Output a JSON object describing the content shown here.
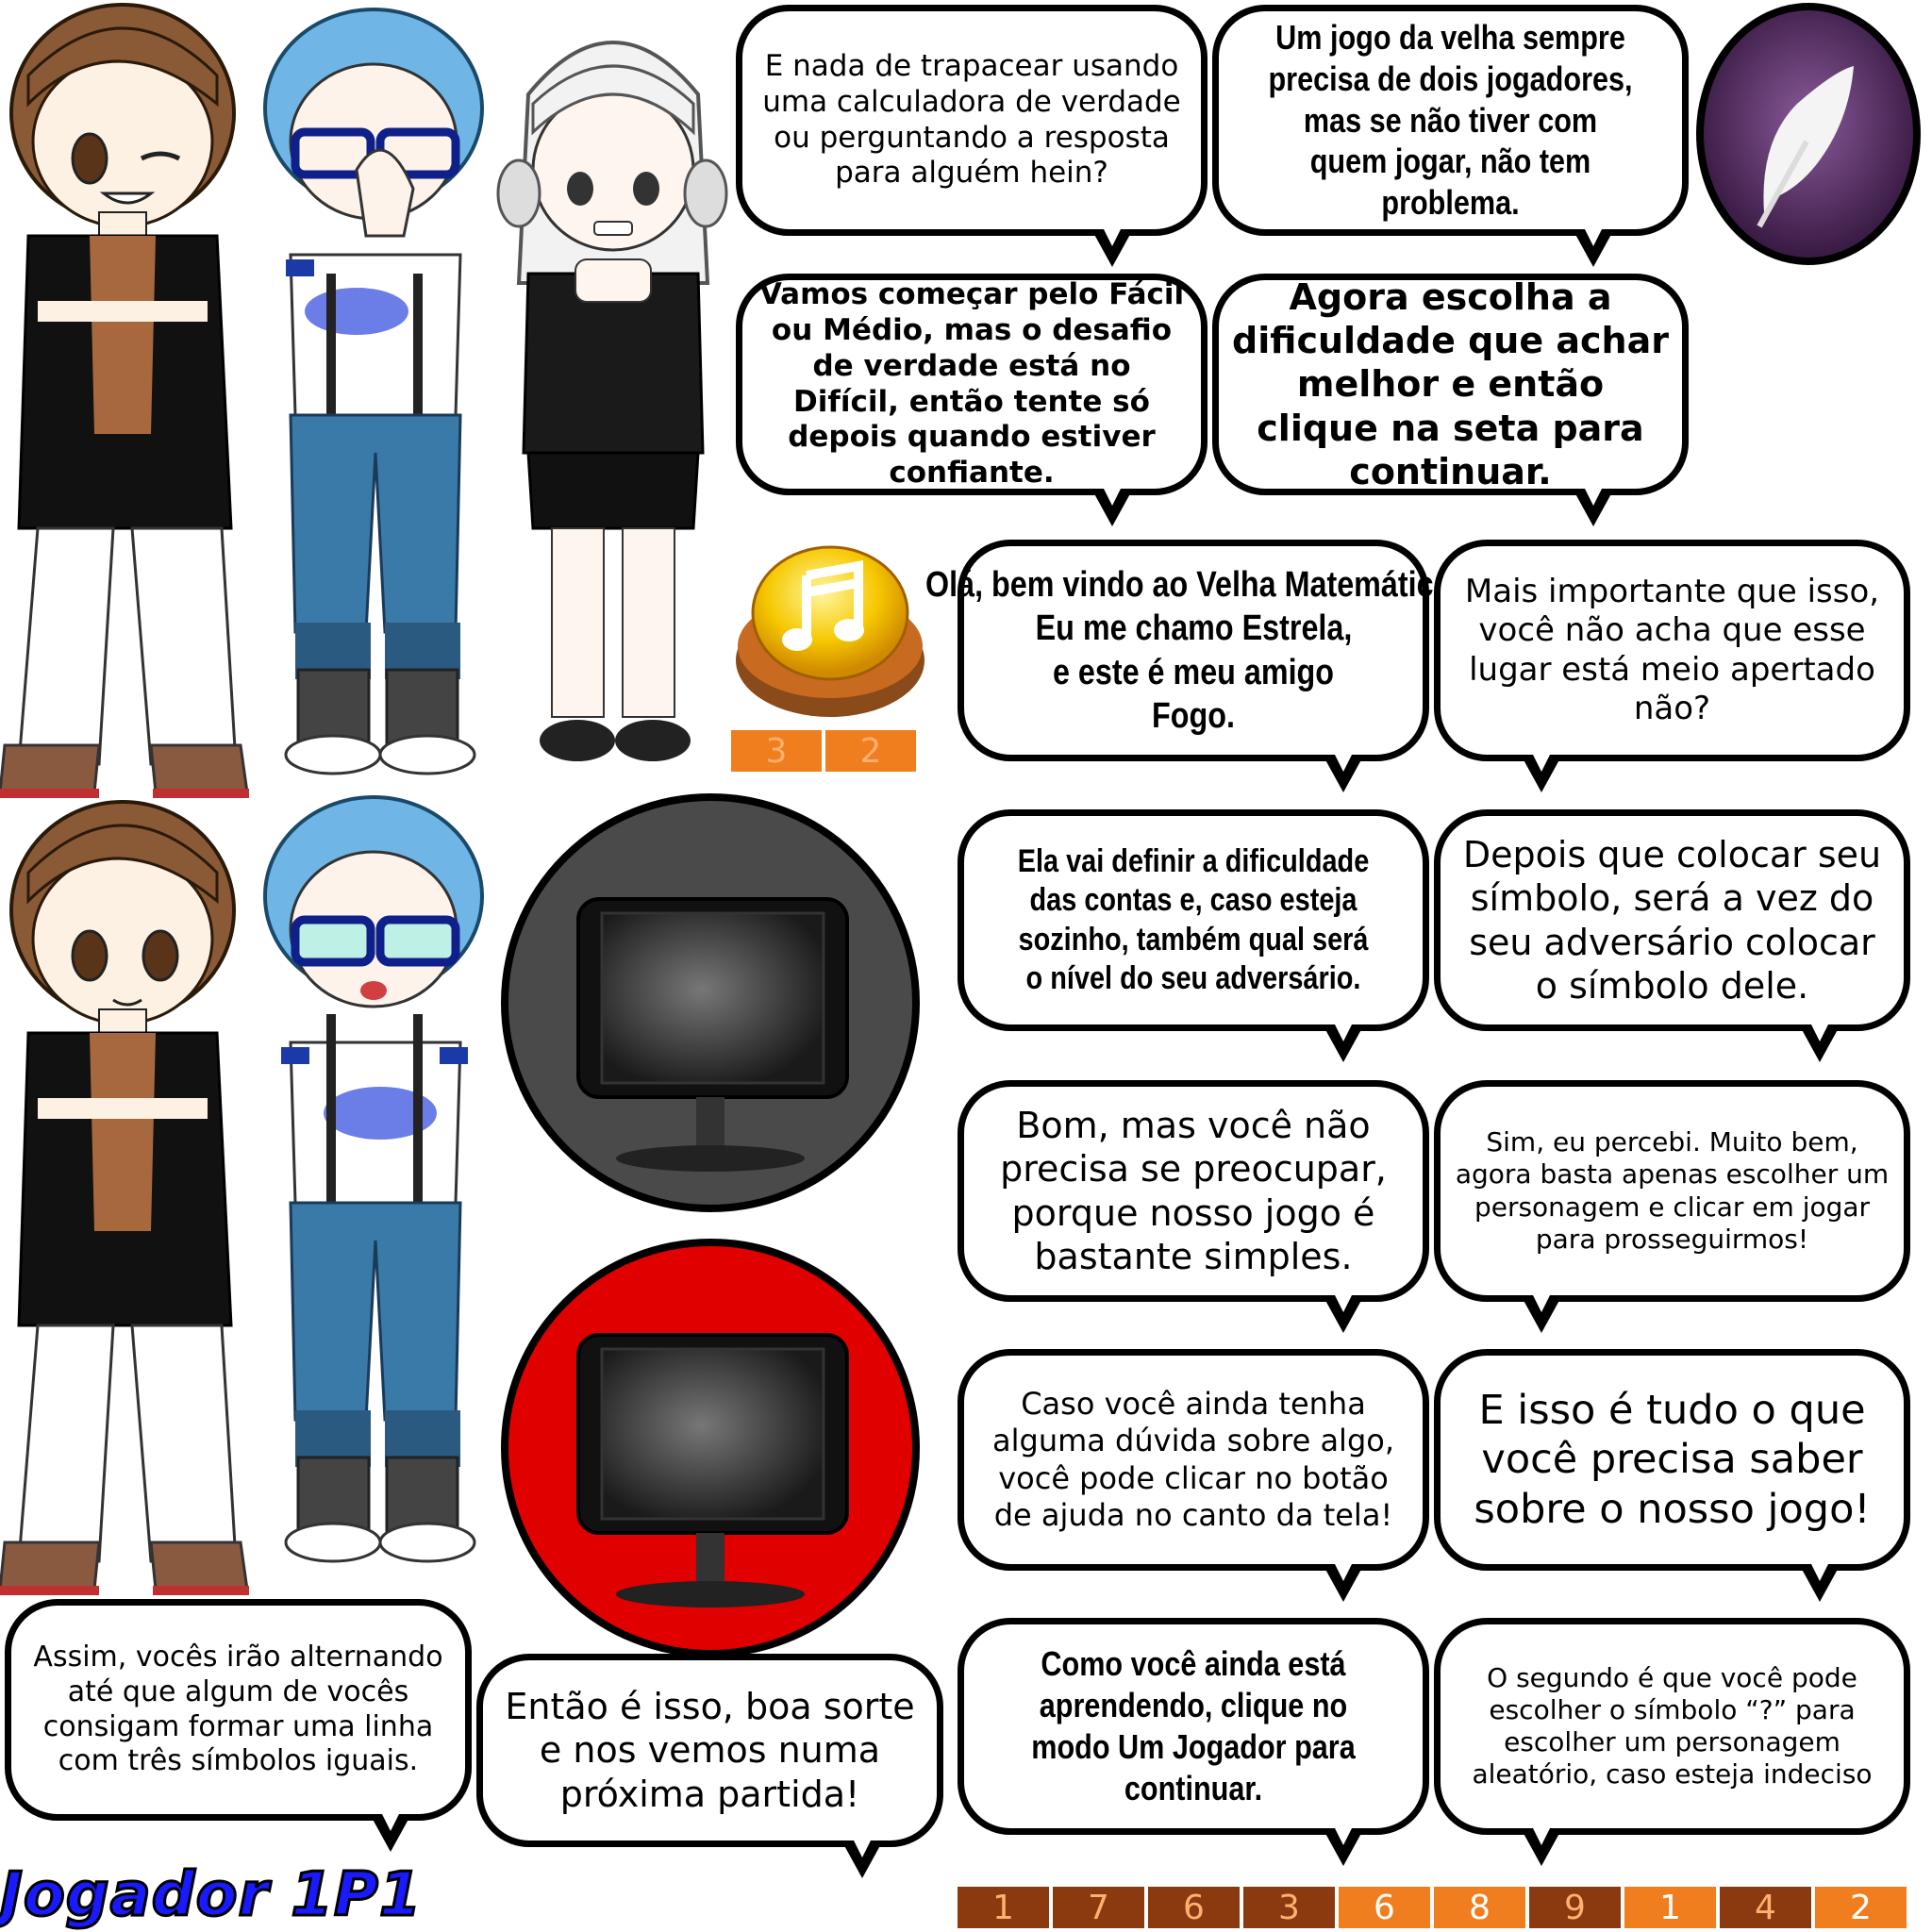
{
  "bubbles": {
    "b1": "E nada de trapacear usando uma calculadora de verdade ou perguntando a resposta para alguém hein?",
    "b2": "Um jogo da velha sempre precisa de dois jogadores, mas se não tiver com quem jogar, não tem problema.",
    "b3": "Vamos começar pelo Fácil ou Médio, mas o desafio de verdade está no Difícil, então tente só depois quando estiver confiante.",
    "b4": "Agora escolha a dificuldade que achar melhor e então clique na seta para continuar.",
    "b5a": "Olá, bem vindo ao Velha Matemática!",
    "b5b": "Eu me chamo Estrela,",
    "b5c": "e este é meu amigo Fogo.",
    "b6": "Mais importante que isso, você não acha que esse lugar está meio apertado não?",
    "b7": "Ela vai definir a dificuldade das contas e, caso esteja sozinho, também qual será o nível do seu adversário.",
    "b8": "Depois que colocar seu símbolo, será a vez do seu adversário colocar o símbolo dele.",
    "b9": "Bom, mas você não precisa se preocupar, porque nosso jogo é bastante simples.",
    "b10": "Sim, eu percebi. Muito bem, agora basta apenas escolher um personagem e clicar em jogar para prosseguirmos!",
    "b11": "Caso você ainda tenha alguma dúvida sobre algo, você pode clicar no botão de ajuda no canto da tela!",
    "b12": "E isso é tudo o que você precisa saber sobre o nosso jogo!",
    "b13": "Assim, vocês irão alternando até que algum de vocês consigam formar uma linha com três símbolos iguais.",
    "b14": "Então é isso, boa sorte e nos vemos numa próxima partida!",
    "b15": "Como você ainda está aprendendo, clique no modo Um Jogador para continuar.",
    "b16": "O segundo é que você pode escolher o símbolo “?” para escolher um personagem aleatório, caso esteja indeciso"
  },
  "music_digits": [
    "3",
    "2"
  ],
  "bottom_digits": [
    "1",
    "7",
    "6",
    "3",
    "6",
    "8",
    "9",
    "1",
    "4",
    "2"
  ],
  "player_label": "Jogador 1P1",
  "colors": {
    "orange": "#f07d1e",
    "dark_orange": "#8a3a0e",
    "red_button": "#e00000",
    "gray_button": "#4a4a4a",
    "purple": "#4a2a55",
    "title_blue": "#1a1aff"
  },
  "icons": [
    "feather-icon",
    "music-note-icon",
    "monitor-icon"
  ]
}
